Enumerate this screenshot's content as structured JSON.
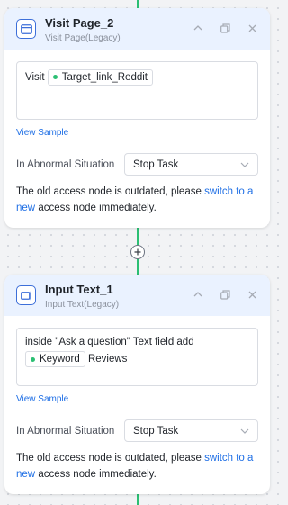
{
  "nodes": [
    {
      "title": "Visit Page_2",
      "subtitle": "Visit Page(Legacy)",
      "icon": "browser-window-icon",
      "content_prefix": "Visit",
      "content_tag": "Target_link_Reddit",
      "view_sample": "View Sample",
      "abnormal_label": "In Abnormal Situation",
      "abnormal_value": "Stop Task",
      "note_before": "The old access node is outdated, please",
      "note_link": "switch to a new",
      "note_after": "access node immediately."
    },
    {
      "title": "Input Text_1",
      "subtitle": "Input Text(Legacy)",
      "icon": "text-input-icon",
      "content_prefix": "inside \"Ask a question\" Text field add",
      "content_tag": "Keyword",
      "content_suffix": "Reviews",
      "view_sample": "View Sample",
      "abnormal_label": "In Abnormal Situation",
      "abnormal_value": "Stop Task",
      "note_before": "The old access node is outdated, please",
      "note_link": "switch to a new",
      "note_after": "access node immediately."
    }
  ],
  "colors": {
    "accent": "#1f6fe5",
    "connector": "#2bbf73",
    "header_bg": "#eaf2ff"
  }
}
